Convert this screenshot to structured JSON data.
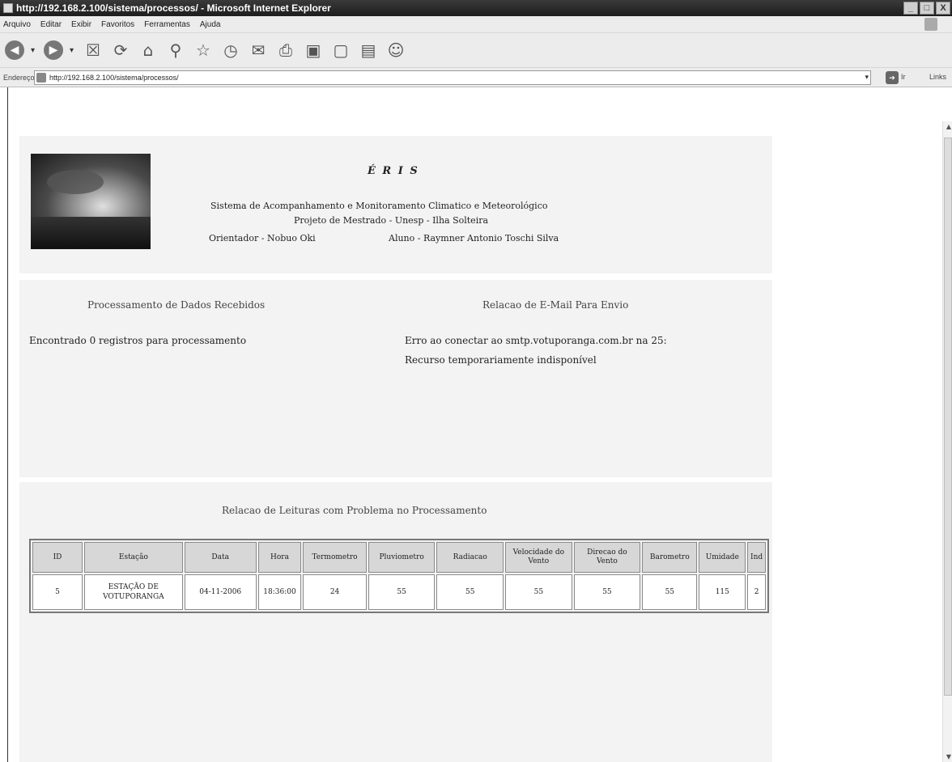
{
  "window": {
    "title": "http://192.168.2.100/sistema/processos/ - Microsoft Internet Explorer",
    "controls": [
      "_",
      "□",
      "X"
    ]
  },
  "menu": {
    "items": [
      "Arquivo",
      "Editar",
      "Exibir",
      "Favoritos",
      "Ferramentas",
      "Ajuda"
    ]
  },
  "toolbar": {
    "buttons": [
      "back-icon",
      "forward-icon",
      "stop-icon",
      "refresh-icon",
      "home-icon",
      "search-icon",
      "favorites-icon",
      "history-icon",
      "mail-icon",
      "print-icon",
      "edit-icon",
      "discuss-icon",
      "research-icon",
      "messenger-icon"
    ]
  },
  "address": {
    "label": "Endereço",
    "url": "http://192.168.2.100/sistema/processos/",
    "go_label": "Ir",
    "links_label": "Links"
  },
  "header": {
    "title": "É R I S",
    "line1": "Sistema de Acompanhamento e Monitoramento Climatico e Meteorológico",
    "line2": "Projeto de Mestrado - Unesp - Ilha Solteira",
    "advisor": "Orientador - Nobuo Oki",
    "student": "Aluno - Raymner Antonio Toschi Silva"
  },
  "processing": {
    "title": "Processamento de Dados Recebidos",
    "message": "Encontrado 0 registros para processamento"
  },
  "email": {
    "title": "Relacao de E-Mail Para Envio",
    "message_line1": "Erro ao conectar ao smtp.votuporanga.com.br na 25:",
    "message_line2": "Recurso temporariamente indisponível"
  },
  "readings": {
    "title": "Relacao de Leituras com Problema no Processamento",
    "columns": [
      "ID",
      "Estação",
      "Data",
      "Hora",
      "Termometro",
      "Pluviometro",
      "Radiacao",
      "Velocidade do Vento",
      "Direcao do Vento",
      "Barometro",
      "Umidade",
      "Ind"
    ],
    "rows": [
      [
        "5",
        "ESTAÇÃO DE VOTUPORANGA",
        "04-11-2006",
        "18:36:00",
        "24",
        "55",
        "55",
        "55",
        "55",
        "55",
        "115",
        "2"
      ]
    ]
  }
}
